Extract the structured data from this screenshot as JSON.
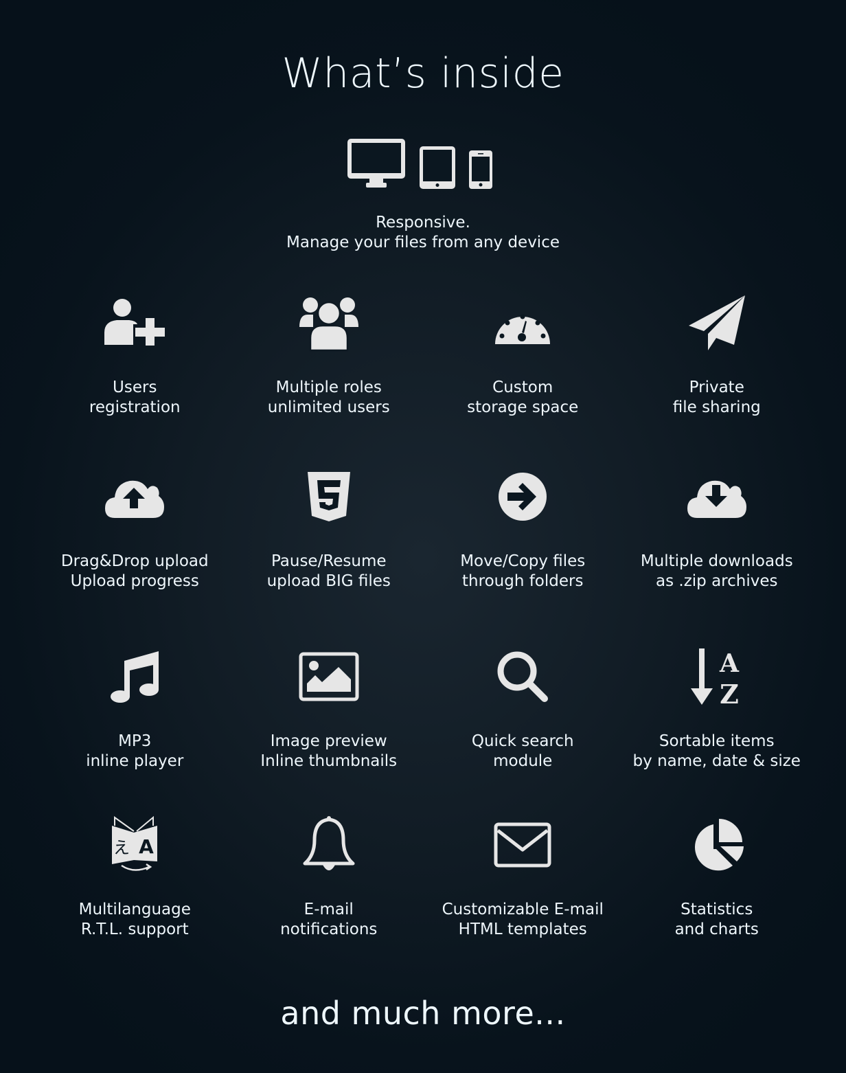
{
  "title": "What’s inside",
  "responsive": {
    "icons": [
      "desktop-icon",
      "tablet-icon",
      "phone-icon"
    ],
    "line1": "Responsive.",
    "line2": "Manage your files from any device"
  },
  "icon_color": "#e8e8e8",
  "features": [
    {
      "icon": "user-plus-icon",
      "line1": "Users",
      "line2": "registration"
    },
    {
      "icon": "users-group-icon",
      "line1": "Multiple roles",
      "line2": "unlimited users"
    },
    {
      "icon": "dashboard-gauge-icon",
      "line1": "Custom",
      "line2": "storage space"
    },
    {
      "icon": "paper-plane-icon",
      "line1": "Private",
      "line2": "file sharing"
    },
    {
      "icon": "cloud-upload-icon",
      "line1": "Drag&Drop upload",
      "line2": "Upload progress"
    },
    {
      "icon": "html5-icon",
      "line1": "Pause/Resume",
      "line2": "upload BIG files"
    },
    {
      "icon": "arrow-circle-right-icon",
      "line1": "Move/Copy files",
      "line2": "through folders"
    },
    {
      "icon": "cloud-download-icon",
      "line1": "Multiple downloads",
      "line2": "as .zip archives"
    },
    {
      "icon": "music-note-icon",
      "line1": "MP3",
      "line2": "inline player"
    },
    {
      "icon": "image-icon",
      "line1": "Image preview",
      "line2": "Inline thumbnails"
    },
    {
      "icon": "search-icon",
      "line1": "Quick search",
      "line2": "module"
    },
    {
      "icon": "sort-alpha-icon",
      "line1": "Sortable items",
      "line2": "by name, date & size"
    },
    {
      "icon": "translate-icon",
      "line1": "Multilanguage",
      "line2": "R.T.L. support"
    },
    {
      "icon": "bell-icon",
      "line1": "E-mail",
      "line2": "notifications"
    },
    {
      "icon": "envelope-icon",
      "line1": "Customizable E-mail",
      "line2": "HTML templates"
    },
    {
      "icon": "pie-chart-icon",
      "line1": "Statistics",
      "line2": "and charts"
    }
  ],
  "footer": "and much more..."
}
